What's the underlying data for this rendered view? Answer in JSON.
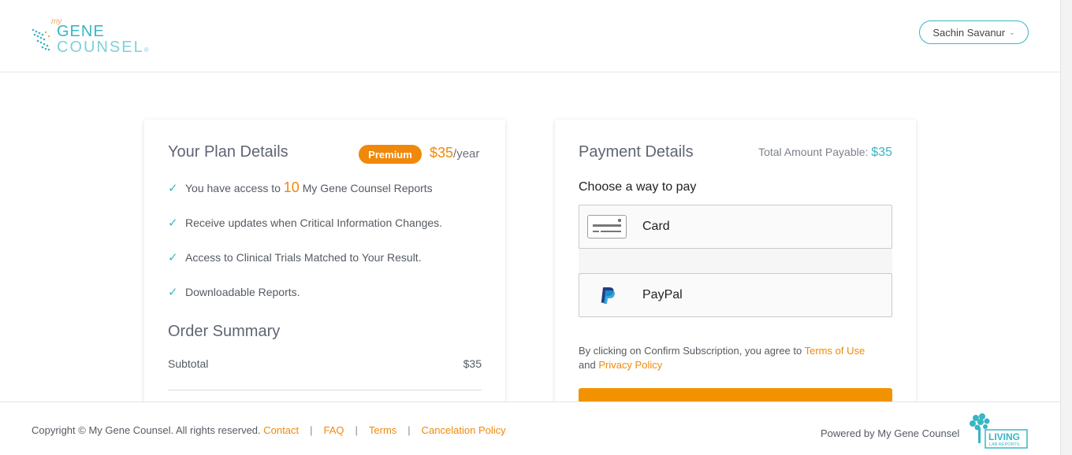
{
  "header": {
    "logo": {
      "my": "my",
      "line1": "GENE",
      "line2": "COUNSEL",
      "mark": "®"
    },
    "user_name": "Sachin Savanur"
  },
  "plan": {
    "title": "Your Plan Details",
    "badge": "Premium",
    "price": "$35",
    "price_unit": "/year",
    "features": [
      {
        "prefix": "You have access to ",
        "highlight": "10",
        "suffix": " My Gene Counsel Reports"
      },
      {
        "text": "Receive updates when Critical Information Changes."
      },
      {
        "text": "Access to Clinical Trials Matched to Your Result."
      },
      {
        "text": "Downloadable Reports."
      }
    ],
    "order_summary_title": "Order Summary",
    "subtotal_label": "Subtotal",
    "subtotal_value": "$35"
  },
  "payment": {
    "title": "Payment Details",
    "total_label": "Total Amount Payable: ",
    "total_value": "$35",
    "choose_label": "Choose a way to pay",
    "options": [
      {
        "label": "Card",
        "icon": "credit-card-icon"
      },
      {
        "label": "PayPal",
        "icon": "paypal-icon"
      }
    ],
    "terms_prefix": "By clicking on Confirm Subscription, you agree to ",
    "terms_link": "Terms of Use",
    "terms_and": "and ",
    "privacy_link": "Privacy Policy"
  },
  "footer": {
    "copyright": "Copyright © My Gene Counsel. All rights reserved.",
    "links": [
      "Contact",
      "FAQ",
      "Terms",
      "Cancelation Policy"
    ],
    "powered_by": "Powered by My Gene Counsel",
    "partner_logo": {
      "line1": "LIVING",
      "line2": "LAB REPORTS"
    }
  },
  "colors": {
    "accent_orange": "#f0890a",
    "accent_teal": "#3ab5c4",
    "button_orange": "#f39200"
  }
}
